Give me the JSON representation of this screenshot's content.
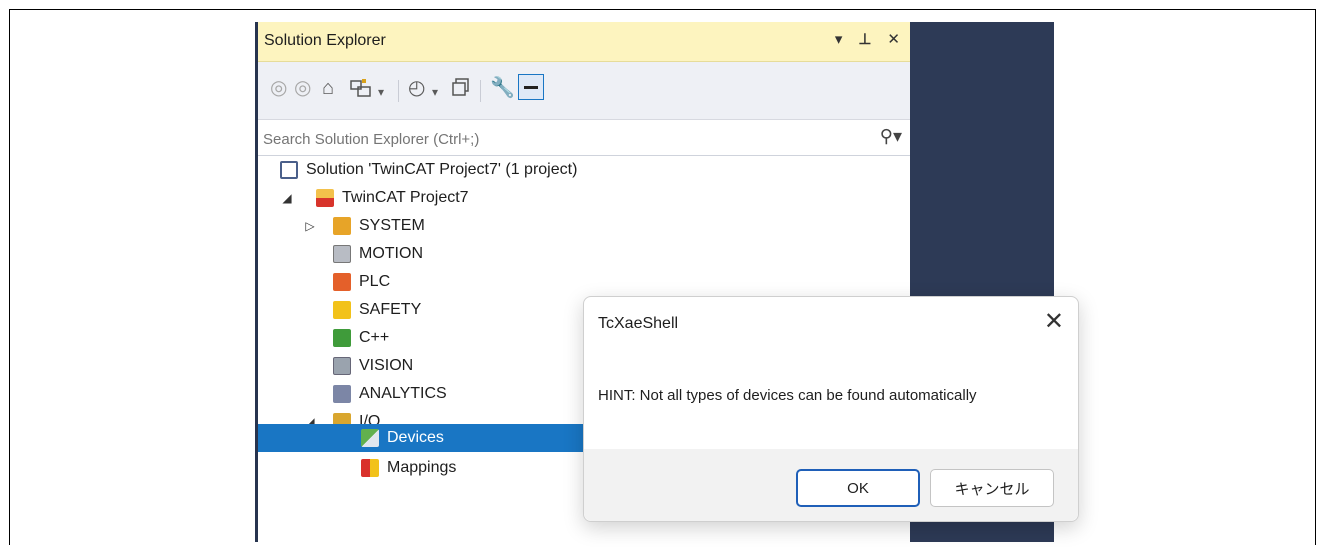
{
  "panel": {
    "title": "Solution Explorer",
    "title_icons": [
      "dropdown-icon",
      "pin-icon",
      "close-icon"
    ],
    "title_dropdown": "▾",
    "title_pin": "ᵖ",
    "title_close": "✕"
  },
  "toolbar": {
    "icons": [
      "back-icon",
      "forward-icon",
      "home-icon",
      "switch-view-icon",
      "pending-changes-icon",
      "collapse-all-icon",
      "properties-icon",
      "preview-icon"
    ]
  },
  "search": {
    "placeholder": "Search Solution Explorer (Ctrl+;)",
    "icon": "search-icon"
  },
  "tree": {
    "solution": "Solution 'TwinCAT Project7' (1 project)",
    "project": "TwinCAT Project7",
    "items": [
      {
        "label": "SYSTEM"
      },
      {
        "label": "MOTION"
      },
      {
        "label": "PLC"
      },
      {
        "label": "SAFETY"
      },
      {
        "label": "C++"
      },
      {
        "label": "VISION"
      },
      {
        "label": "ANALYTICS"
      },
      {
        "label": "I/O"
      },
      {
        "label": "Devices"
      },
      {
        "label": "Mappings"
      }
    ],
    "selected": "Devices"
  },
  "dialog": {
    "title": "TcXaeShell",
    "message": "HINT: Not all types of devices can be found automatically",
    "ok_label": "OK",
    "cancel_label": "キャンセル",
    "close_glyph": "✕"
  },
  "colors": {
    "title_bar": "#fdf4bf",
    "selection": "#1976c4",
    "ide_background": "#2d3a56"
  }
}
